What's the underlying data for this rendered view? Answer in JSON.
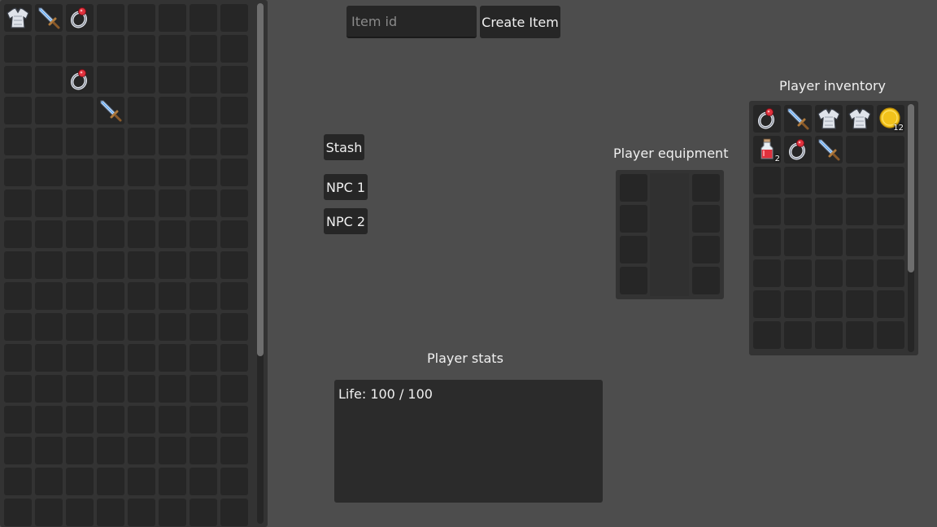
{
  "stash": {
    "cols": 8,
    "rows": 17,
    "items": [
      {
        "index": 0,
        "icon": "armor-icon"
      },
      {
        "index": 1,
        "icon": "sword-icon"
      },
      {
        "index": 2,
        "icon": "ring-icon"
      },
      {
        "index": 18,
        "icon": "ring-icon"
      },
      {
        "index": 27,
        "icon": "sword-icon"
      }
    ]
  },
  "create_item": {
    "placeholder": "Item id",
    "button_label": "Create Item"
  },
  "nav_buttons": {
    "stash_label": "Stash",
    "npc1_label": "NPC 1",
    "npc2_label": "NPC 2"
  },
  "equipment": {
    "title": "Player equipment",
    "slots": 8
  },
  "inventory": {
    "title": "Player inventory",
    "cols": 5,
    "rows": 8,
    "items": [
      {
        "index": 0,
        "icon": "ring-icon"
      },
      {
        "index": 1,
        "icon": "sword-icon"
      },
      {
        "index": 2,
        "icon": "armor-icon"
      },
      {
        "index": 3,
        "icon": "armor-icon"
      },
      {
        "index": 4,
        "icon": "gold-coin-icon",
        "count": "12"
      },
      {
        "index": 5,
        "icon": "potion-icon",
        "count": "2"
      },
      {
        "index": 6,
        "icon": "ring-icon"
      },
      {
        "index": 7,
        "icon": "sword-icon"
      }
    ]
  },
  "stats": {
    "title": "Player stats",
    "life_line": "Life:  100 / 100"
  }
}
